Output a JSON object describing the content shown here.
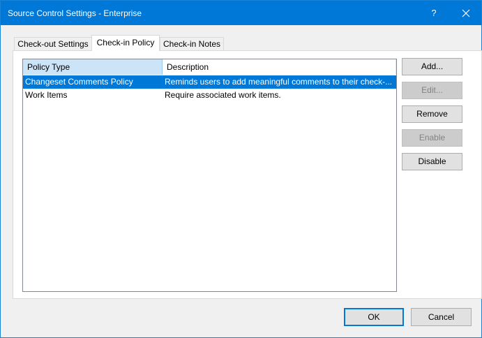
{
  "window": {
    "title": "Source Control Settings - Enterprise",
    "help_glyph": "?",
    "close_glyph": "✕"
  },
  "tabs": [
    {
      "label": "Check-out Settings",
      "active": false
    },
    {
      "label": "Check-in Policy",
      "active": true
    },
    {
      "label": "Check-in Notes",
      "active": false
    }
  ],
  "policy_list": {
    "columns": [
      "Policy Type",
      "Description"
    ],
    "rows": [
      {
        "type": "Changeset Comments Policy",
        "description": "Reminds users to add meaningful comments to their check-...",
        "selected": true
      },
      {
        "type": "Work Items",
        "description": "Require associated work items.",
        "selected": false
      }
    ]
  },
  "side_buttons": {
    "add": {
      "label": "Add...",
      "enabled": true
    },
    "edit": {
      "label": "Edit...",
      "enabled": false
    },
    "remove": {
      "label": "Remove",
      "enabled": true
    },
    "enable": {
      "label": "Enable",
      "enabled": false
    },
    "disable": {
      "label": "Disable",
      "enabled": true
    }
  },
  "footer": {
    "ok_label": "OK",
    "cancel_label": "Cancel"
  },
  "colors": {
    "titlebar": "#0078d7",
    "selection": "#0078d7",
    "header_highlight": "#cce4f7"
  }
}
